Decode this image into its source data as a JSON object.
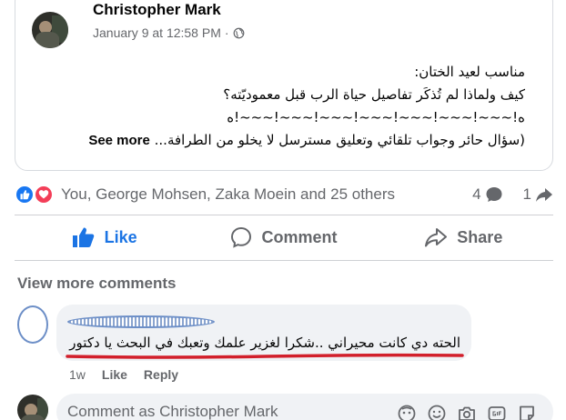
{
  "post": {
    "author": "Christopher Mark",
    "timestamp": "January 9 at 12:58 PM",
    "separator": "·",
    "privacy_icon": "globe-icon",
    "lines": [
      "مناسب لعيد الختان:",
      "كيف ولماذا لم تُذكَر تفاصيل حياة الرب قبل معموديّته؟",
      "ه!~~~!~~~!~~~!~~~!~~~!~~~!~~~!ه"
    ],
    "last_line": "(سؤال حائر وجواب تلقائي وتعليق مسترسل لا يخلو من الطرافة...",
    "see_more": "See more"
  },
  "reactions": {
    "summary": "You, George Mohsen, Zaka Moein and 25 others",
    "comments_count": "4",
    "shares_count": "1",
    "icons": [
      "like-reaction-icon",
      "love-reaction-icon"
    ]
  },
  "actions": {
    "like": "Like",
    "comment": "Comment",
    "share": "Share"
  },
  "comments": {
    "view_more": "View more comments",
    "items": [
      {
        "text": "الحته دي كانت محيراني ..شكرا لغزير علمك وتعبك في البحث يا دكتور",
        "time": "1w",
        "like": "Like",
        "reply": "Reply"
      }
    ],
    "input_placeholder": "Comment as Christopher Mark",
    "input_icons": [
      "avatar-sticker-icon",
      "emoji-icon",
      "camera-icon",
      "gif-icon",
      "sticker-icon"
    ]
  },
  "colors": {
    "accent": "#1b74e4",
    "muted": "#65676b",
    "bubble": "#f0f2f5",
    "annotation_red": "#d21f2b",
    "annotation_blue": "#6d8fc7"
  }
}
